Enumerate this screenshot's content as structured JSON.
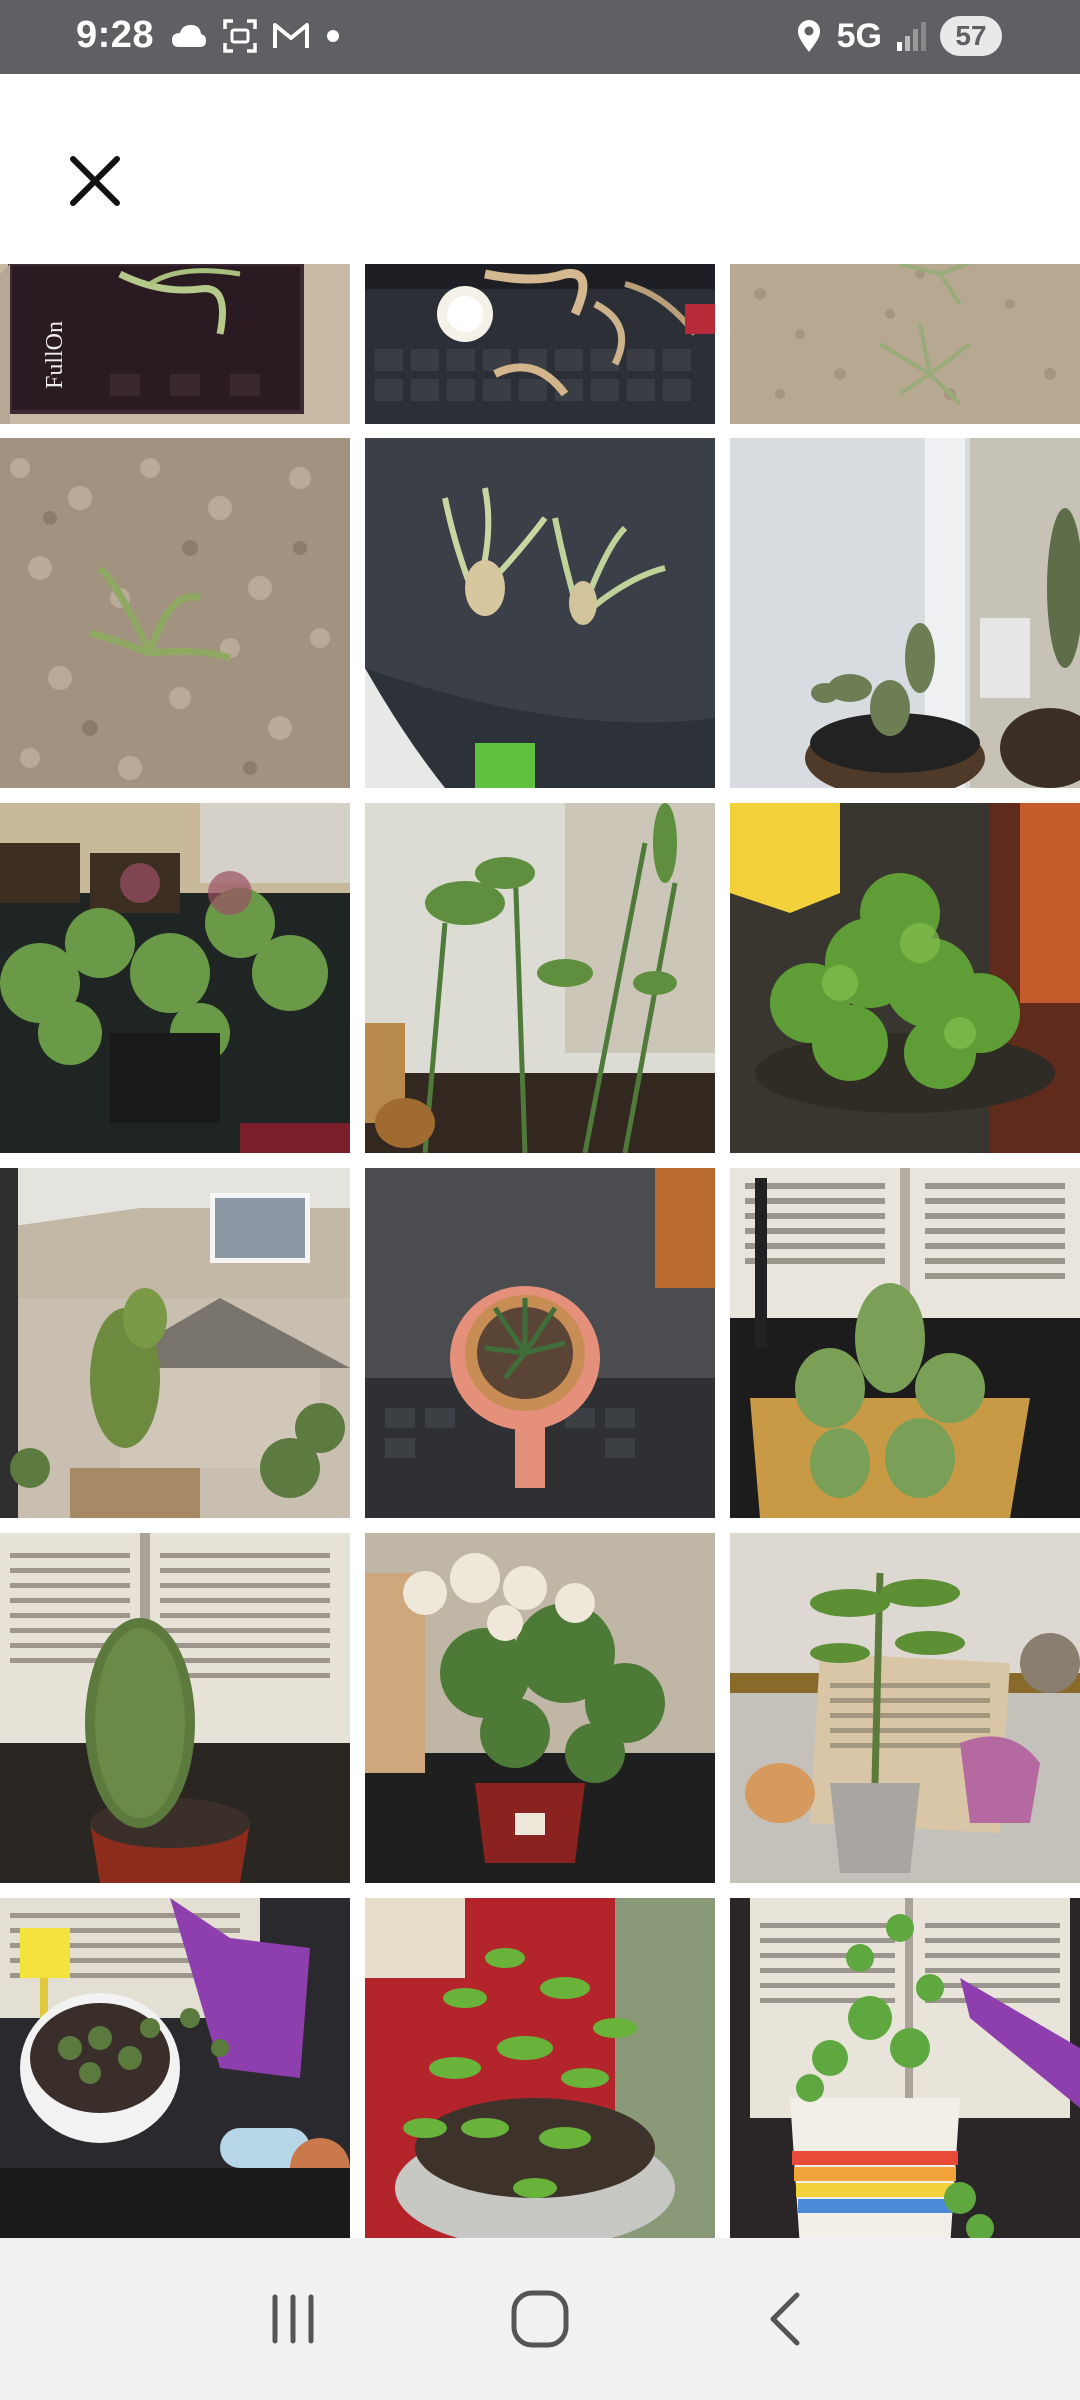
{
  "status_bar": {
    "time": "9:28",
    "network": "5G",
    "battery": "57",
    "left_icons": [
      "cloud-icon",
      "screenshot-icon",
      "gmail-icon",
      "dot-icon"
    ],
    "right_icons": [
      "location-icon",
      "signal-icon"
    ]
  },
  "header": {
    "close_icon": "close-icon"
  },
  "gallery": {
    "columns": 3,
    "photos": [
      {
        "subject": "air plant on black tray with text"
      },
      {
        "subject": "air plants on keyboard"
      },
      {
        "subject": "air plant on carpet"
      },
      {
        "subject": "air plant on carpet"
      },
      {
        "subject": "two air plants on dark cloth"
      },
      {
        "subject": "cactus by window"
      },
      {
        "subject": "geranium plants"
      },
      {
        "subject": "plants by window"
      },
      {
        "subject": "hanging fern basket"
      },
      {
        "subject": "cactus by window with houses"
      },
      {
        "subject": "small succulent in pink pot"
      },
      {
        "subject": "cactus cluster with open book"
      },
      {
        "subject": "cactus with open book"
      },
      {
        "subject": "white chrysanthemum"
      },
      {
        "subject": "avocado seedling with book"
      },
      {
        "subject": "small plant in white pot"
      },
      {
        "subject": "mimosa plant"
      },
      {
        "subject": "plant in rainbow pot with book"
      }
    ],
    "tray_text": "FullOn"
  },
  "nav_bar": {
    "icons": [
      "recent-apps-icon",
      "home-icon",
      "back-icon"
    ]
  },
  "colors": {
    "status_bar_bg": "#5f6064",
    "nav_bar_bg": "#f1f1f3"
  }
}
